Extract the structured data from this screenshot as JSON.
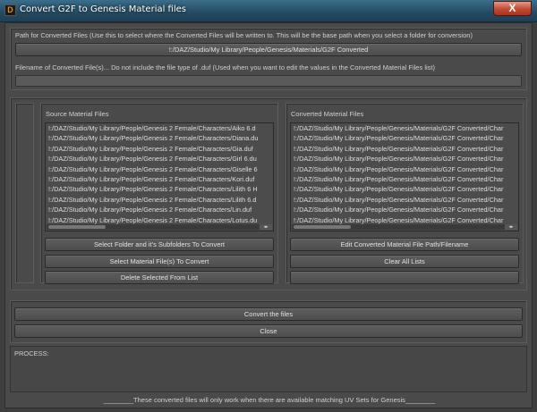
{
  "window": {
    "title": "Convert G2F to Genesis Material files",
    "close_symbol": "X"
  },
  "path_section": {
    "label": "Path for Converted Files (Use this to select where the Converted Files will be written to. This will be the base path when you select a folder for conversion)",
    "path_button": "!:/DAZ/Studio/My Library/People/Genesis/Materials/G2F Converted",
    "filename_label": "Filename of Converted File(s)... Do not include the file type of .duf (Used when you want to edit the values in the Converted Material Files list)",
    "filename_value": ""
  },
  "source": {
    "heading": "Source Material Files",
    "items": [
      "!:/DAZ/Studio/My Library/People/Genesis 2 Female/Characters/Aiko 6.d",
      "!:/DAZ/Studio/My Library/People/Genesis 2 Female/Characters/Diana.du",
      "!:/DAZ/Studio/My Library/People/Genesis 2 Female/Characters/Gia.duf",
      "!:/DAZ/Studio/My Library/People/Genesis 2 Female/Characters/Girl 6.du",
      "!:/DAZ/Studio/My Library/People/Genesis 2 Female/Characters/Giselle 6",
      "!:/DAZ/Studio/My Library/People/Genesis 2 Female/Characters/Kori.duf",
      "!:/DAZ/Studio/My Library/People/Genesis 2 Female/Characters/Lilith 6 H",
      "!:/DAZ/Studio/My Library/People/Genesis 2 Female/Characters/Lilith 6.d",
      "!:/DAZ/Studio/My Library/People/Genesis 2 Female/Characters/Lin.duf",
      "!:/DAZ/Studio/My Library/People/Genesis 2 Female/Characters/Lotus.du"
    ],
    "buttons": {
      "select_folder": "Select Folder and it's Subfolders To Convert",
      "select_files": "Select Material File(s) To Convert",
      "delete_selected": "Delete Selected From List"
    }
  },
  "converted": {
    "heading": "Converted Material Files",
    "items": [
      "!:/DAZ/Studio/My Library/People/Genesis/Materials/G2F Converted/Char",
      "!:/DAZ/Studio/My Library/People/Genesis/Materials/G2F Converted/Char",
      "!:/DAZ/Studio/My Library/People/Genesis/Materials/G2F Converted/Char",
      "!:/DAZ/Studio/My Library/People/Genesis/Materials/G2F Converted/Char",
      "!:/DAZ/Studio/My Library/People/Genesis/Materials/G2F Converted/Char",
      "!:/DAZ/Studio/My Library/People/Genesis/Materials/G2F Converted/Char",
      "!:/DAZ/Studio/My Library/People/Genesis/Materials/G2F Converted/Char",
      "!:/DAZ/Studio/My Library/People/Genesis/Materials/G2F Converted/Char",
      "!:/DAZ/Studio/My Library/People/Genesis/Materials/G2F Converted/Char",
      "!:/DAZ/Studio/My Library/People/Genesis/Materials/G2F Converted/Char"
    ],
    "buttons": {
      "edit_path": "Edit Converted Material File Path/Filename",
      "clear_all": "Clear All Lists",
      "blank": ""
    }
  },
  "actions": {
    "convert": "Convert the files",
    "close": "Close"
  },
  "process": {
    "label": "PROCESS:"
  },
  "footer_note": "________These converted files will only work when there are available matching UV Sets for Genesis________",
  "colors": {
    "background": "#4a4a4a",
    "titlebar": "#244a61",
    "close_button": "#c24a33",
    "app_icon_accent": "#e88a1a"
  }
}
